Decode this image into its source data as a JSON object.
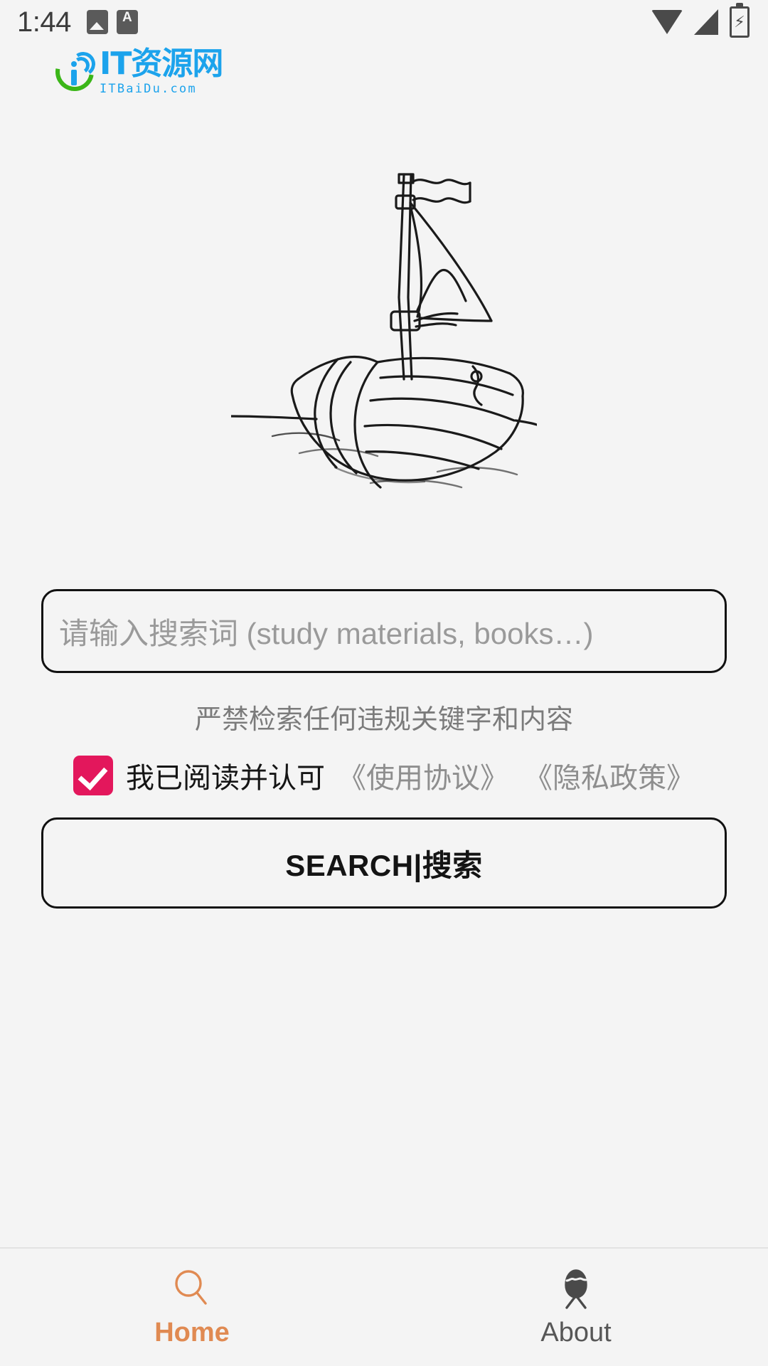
{
  "status_bar": {
    "time": "1:44",
    "left_icons": [
      "photo-icon",
      "letter-a-icon"
    ],
    "right_icons": [
      "wifi-icon",
      "signal-icon",
      "battery-charging-icon"
    ],
    "battery_glyph": "⚡"
  },
  "logo": {
    "title": "IT资源网",
    "subtitle": "ITBaiDu.com",
    "mark_name": "it-resource-network-logo",
    "brand_blue": "#1ca3ec",
    "brand_green": "#3bb618"
  },
  "illustration": {
    "name": "sailboat-line-drawing",
    "stroke_color": "#1a1a1a",
    "alt": "sailboat"
  },
  "search": {
    "placeholder": "请输入搜索词 (study materials, books…)",
    "value": "",
    "warning": "严禁检索任何违规关键字和内容",
    "agreement": {
      "checked": true,
      "checkbox_color": "#e3175c",
      "label": "我已阅读并认可",
      "links": [
        "《使用协议》",
        "《隐私政策》"
      ]
    },
    "button_label": "SEARCH|搜索"
  },
  "bottom_nav": {
    "active_color": "#e08a52",
    "inactive_color": "#575757",
    "items": [
      {
        "label": "Home",
        "icon": "search-icon",
        "active": true
      },
      {
        "label": "About",
        "icon": "person-icon",
        "active": false
      }
    ]
  }
}
